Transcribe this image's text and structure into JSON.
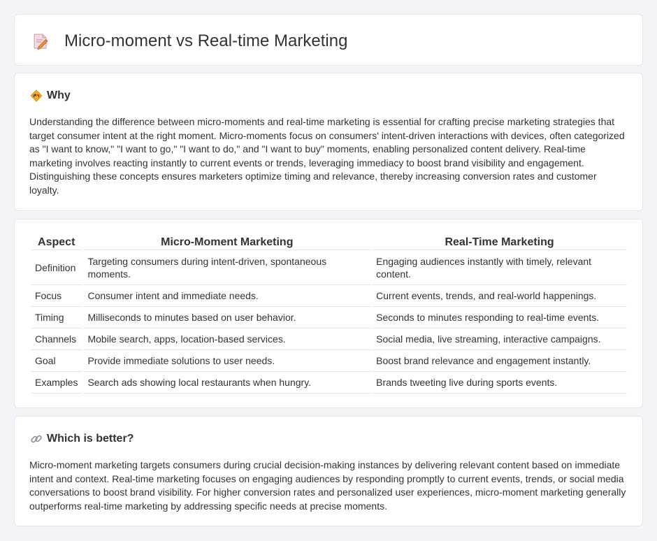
{
  "header": {
    "title": "Micro-moment vs Real-time Marketing",
    "icon": "document-pencil-icon"
  },
  "why": {
    "icon": "signpost-diamond-icon",
    "title": "Why",
    "text": "Understanding the difference between micro-moments and real-time marketing is essential for crafting precise marketing strategies that target consumer intent at the right moment. Micro-moments focus on consumers' intent-driven interactions with devices, often categorized as \"I want to know,\" \"I want to go,\" \"I want to do,\" and \"I want to buy\" moments, enabling personalized content delivery. Real-time marketing involves reacting instantly to current events or trends, leveraging immediacy to boost brand visibility and engagement. Distinguishing these concepts ensures marketers optimize timing and relevance, thereby increasing conversion rates and customer loyalty."
  },
  "table": {
    "headers": [
      "Aspect",
      "Micro-Moment Marketing",
      "Real-Time Marketing"
    ],
    "rows": [
      [
        "Definition",
        "Targeting consumers during intent-driven, spontaneous moments.",
        "Engaging audiences instantly with timely, relevant content."
      ],
      [
        "Focus",
        "Consumer intent and immediate needs.",
        "Current events, trends, and real-world happenings."
      ],
      [
        "Timing",
        "Milliseconds to minutes based on user behavior.",
        "Seconds to minutes responding to real-time events."
      ],
      [
        "Channels",
        "Mobile search, apps, location-based services.",
        "Social media, live streaming, interactive campaigns."
      ],
      [
        "Goal",
        "Provide immediate solutions to user needs.",
        "Boost brand relevance and engagement instantly."
      ],
      [
        "Examples",
        "Search ads showing local restaurants when hungry.",
        "Brands tweeting live during sports events."
      ]
    ]
  },
  "better": {
    "icon": "link-icon",
    "title": "Which is better?",
    "text": "Micro-moment marketing targets consumers during crucial decision-making instances by delivering relevant content based on immediate intent and context. Real-time marketing focuses on engaging audiences by responding promptly to current events, trends, or social media conversations to boost brand visibility. For higher conversion rates and personalized user experiences, micro-moment marketing generally outperforms real-time marketing by addressing specific needs at precise moments."
  }
}
